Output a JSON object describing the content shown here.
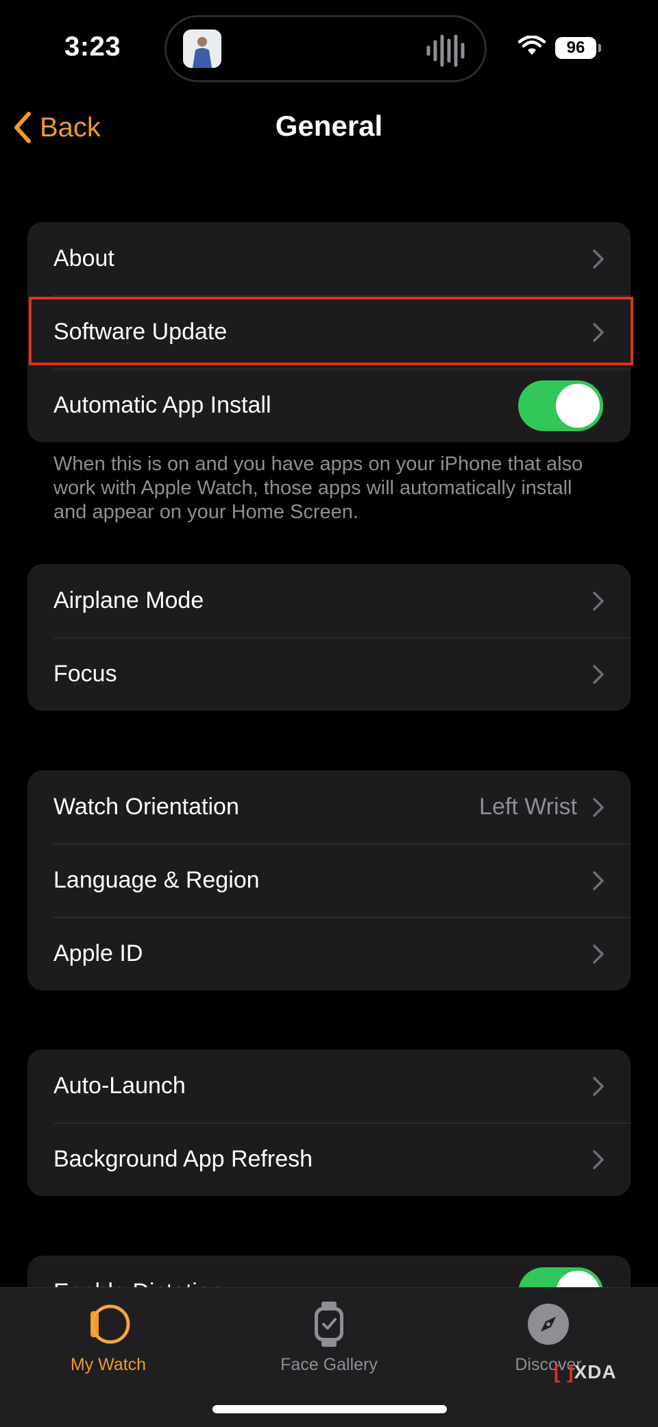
{
  "status_bar": {
    "time": "3:23",
    "battery": "96"
  },
  "nav": {
    "back_label": "Back",
    "title": "General"
  },
  "group1": {
    "about": "About",
    "software_update": "Software Update",
    "auto_app_install": "Automatic App Install",
    "auto_app_install_on": true
  },
  "footnote": "When this is on and you have apps on your iPhone that also work with Apple Watch, those apps will automatically install and appear on your Home Screen.",
  "group2": {
    "airplane_mode": "Airplane Mode",
    "focus": "Focus"
  },
  "group3": {
    "watch_orientation": "Watch Orientation",
    "watch_orientation_value": "Left Wrist",
    "language_region": "Language & Region",
    "apple_id": "Apple ID"
  },
  "group4": {
    "auto_launch": "Auto-Launch",
    "background_app_refresh": "Background App Refresh"
  },
  "group5": {
    "enable_dictation": "Enable Dictation",
    "enable_dictation_on": true
  },
  "tabs": [
    {
      "label": "My Watch",
      "icon": "watch-ring-icon",
      "active": true
    },
    {
      "label": "Face Gallery",
      "icon": "watch-face-icon",
      "active": false
    },
    {
      "label": "Discover",
      "icon": "compass-icon",
      "active": false
    }
  ],
  "watermark": "XDA",
  "colors": {
    "accent": "#f19a2a",
    "toggle_on": "#32c759",
    "highlight": "#e0321f",
    "cell_bg": "#1c1c1e",
    "secondary_text": "#8e8e93"
  }
}
